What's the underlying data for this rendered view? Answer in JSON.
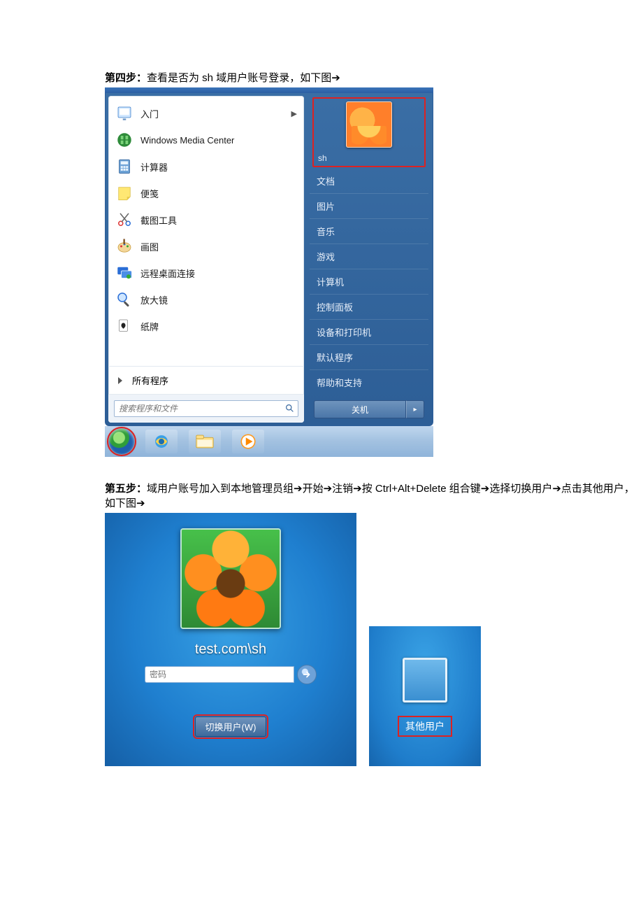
{
  "step4": {
    "prefix": "第四步：",
    "text": "查看是否为 sh 域用户账号登录，如下图➔"
  },
  "startmenu": {
    "left_items": [
      {
        "icon": "getting-started-icon",
        "label": "入门",
        "has_sub": true
      },
      {
        "icon": "wmc-icon",
        "label": "Windows Media Center"
      },
      {
        "icon": "calculator-icon",
        "label": "计算器"
      },
      {
        "icon": "sticky-notes-icon",
        "label": "便笺"
      },
      {
        "icon": "snipping-tool-icon",
        "label": "截图工具"
      },
      {
        "icon": "paint-icon",
        "label": "画图"
      },
      {
        "icon": "rdp-icon",
        "label": "远程桌面连接"
      },
      {
        "icon": "magnifier-icon",
        "label": "放大镜"
      },
      {
        "icon": "solitaire-icon",
        "label": "纸牌"
      }
    ],
    "all_programs": "所有程序",
    "search_placeholder": "搜索程序和文件",
    "username": "sh",
    "right_links": [
      "文档",
      "图片",
      "音乐",
      "游戏",
      "计算机",
      "控制面板",
      "设备和打印机",
      "默认程序",
      "帮助和支持"
    ],
    "shutdown": "关机"
  },
  "step5": {
    "prefix": "第五步：",
    "text_a": "域用户账号加入到本地管理员组➔开始➔注销➔按 Ctrl+Alt+Delete 组合键➔选择切换用户➔点击其他用户，如下图➔"
  },
  "login": {
    "username": "test.com\\sh",
    "password_placeholder": "密码",
    "switch_user": "切换用户(W)",
    "other_user": "其他用户"
  }
}
